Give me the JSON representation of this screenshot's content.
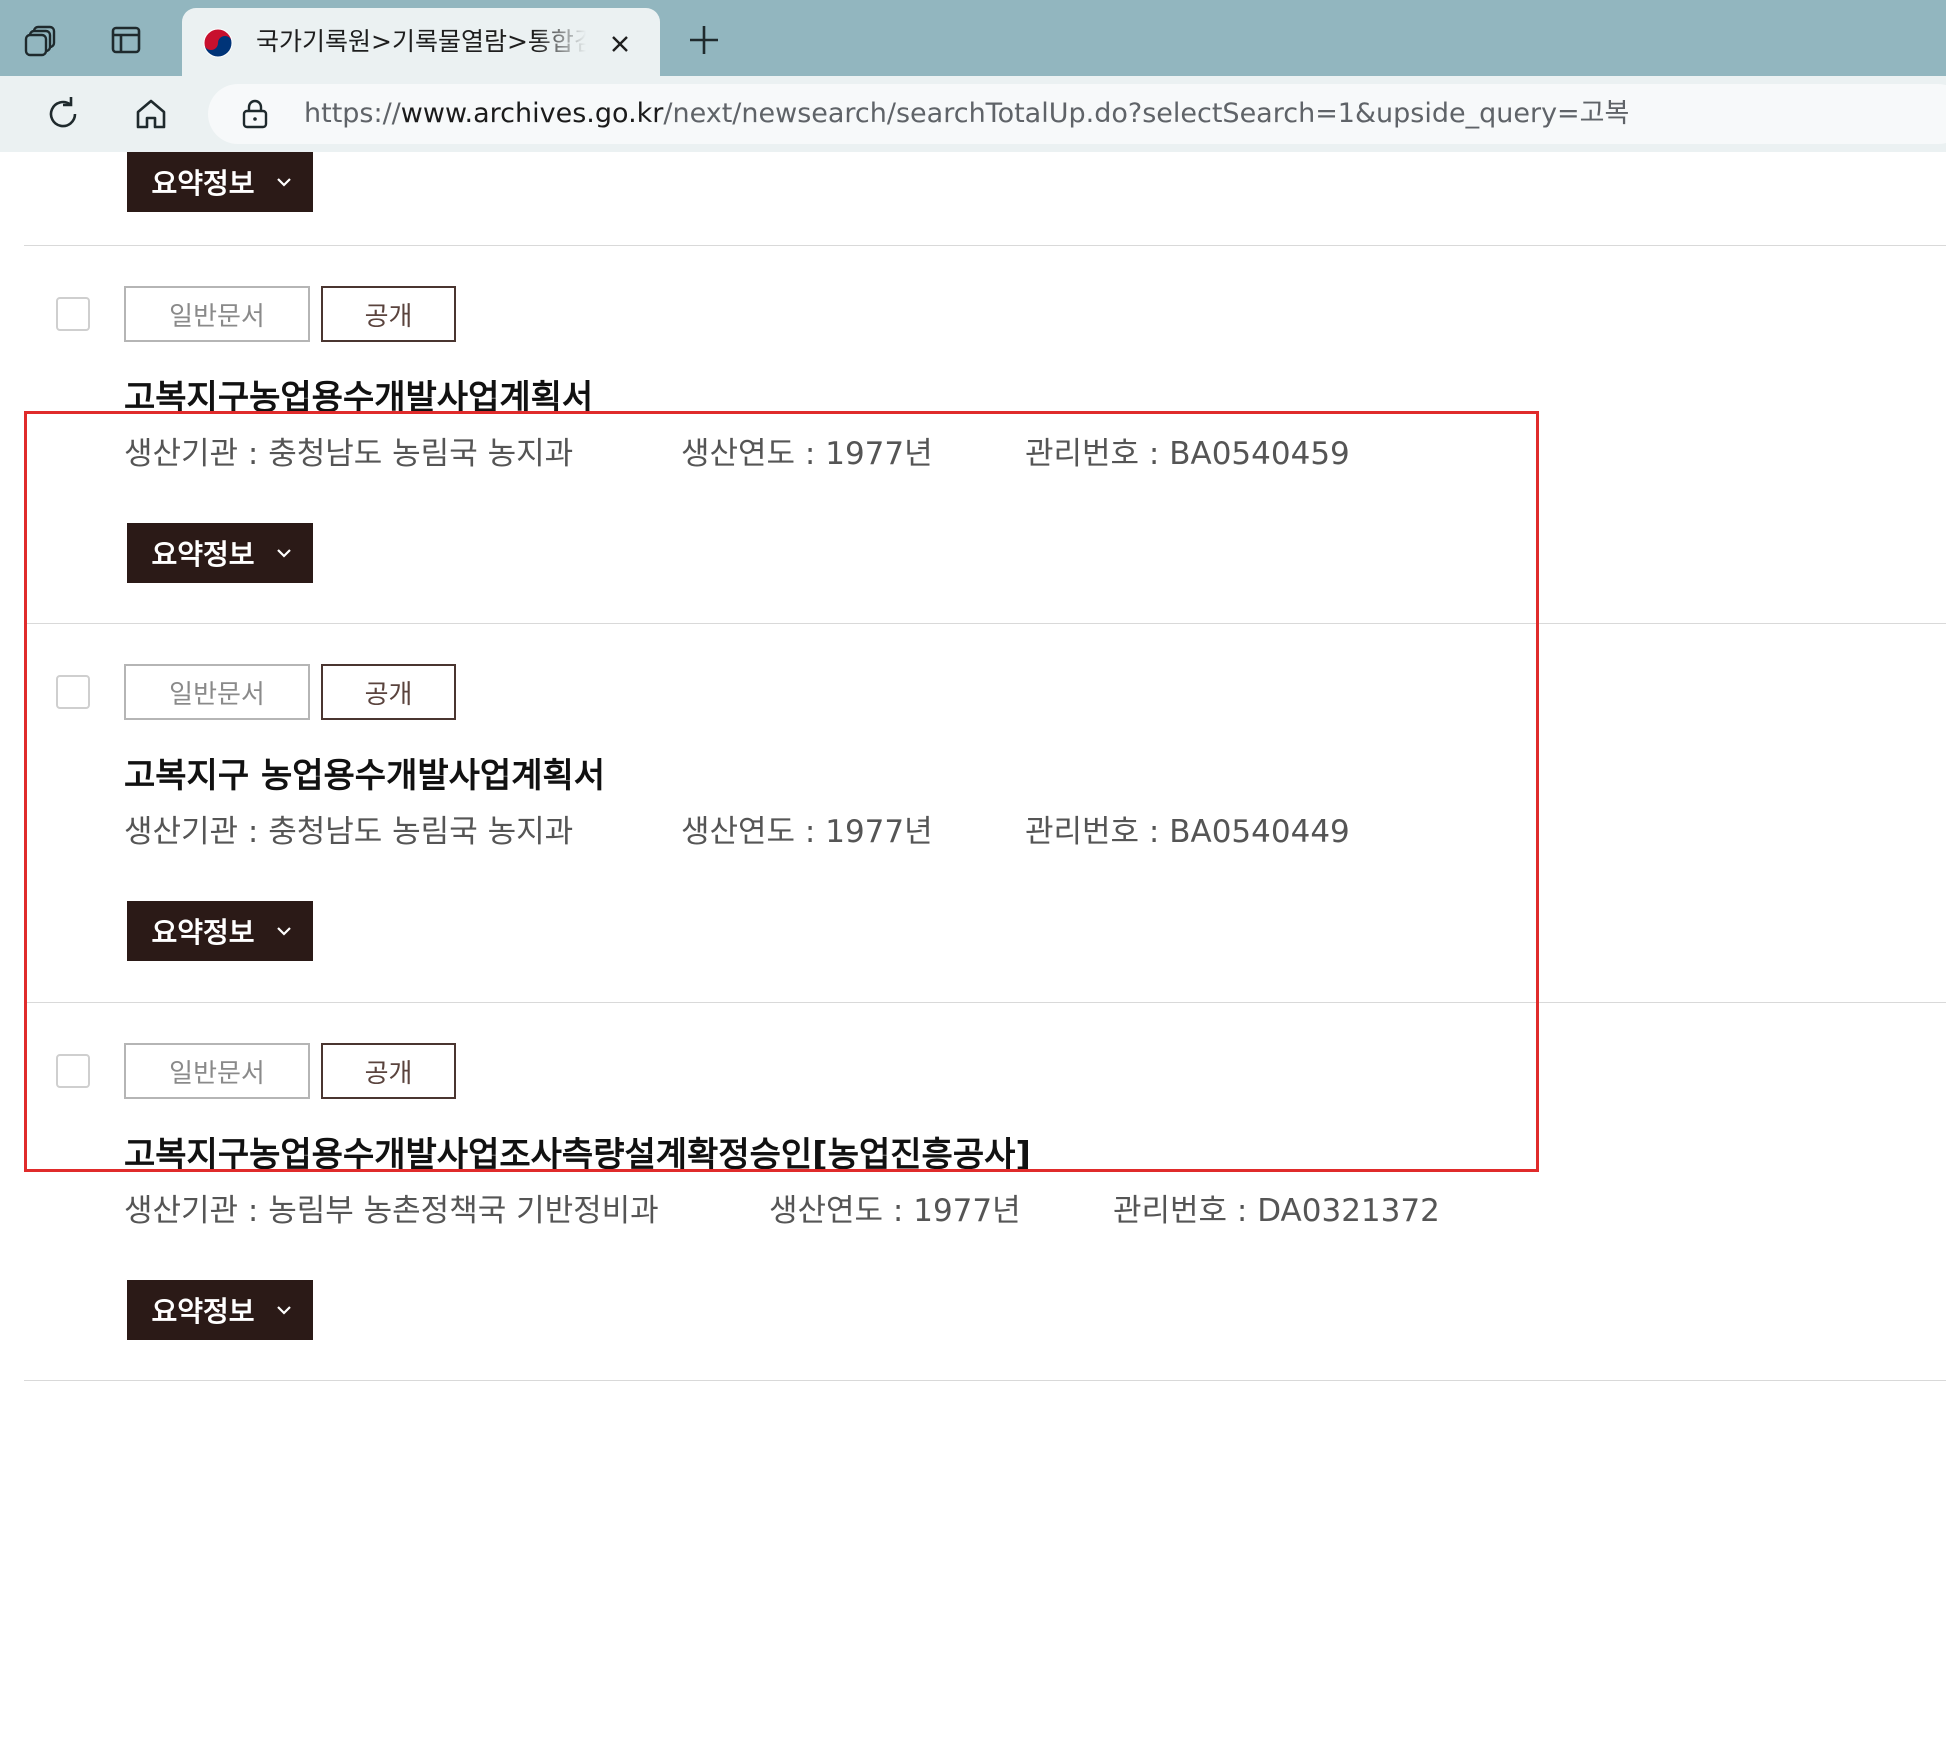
{
  "browser": {
    "tab_title": "국가기록원>기록물열람>통합검색",
    "url_scheme": "https://",
    "url_host": "www.archives.go.kr",
    "url_rest": "/next/newsearch/searchTotalUp.do?selectSearch=1&upside_query=고복"
  },
  "summary_label": "요약정보",
  "results": [
    {
      "type_badge": "일반문서",
      "access_badge": "공개",
      "title": "고복지구농업용수개발사업계획서",
      "producer": "생산기관 : 충청남도 농림국 농지과",
      "year": "생산연도 : 1977년",
      "id": "관리번호 : BA0540459"
    },
    {
      "type_badge": "일반문서",
      "access_badge": "공개",
      "title": "고복지구 농업용수개발사업계획서",
      "producer": "생산기관 : 충청남도 농림국 농지과",
      "year": "생산연도 : 1977년",
      "id": "관리번호 : BA0540449"
    },
    {
      "type_badge": "일반문서",
      "access_badge": "공개",
      "title": "고복지구농업용수개발사업조사측량설계확정승인[농업진흥공사]",
      "producer": "생산기관 : 농림부 농촌정책국 기반정비과",
      "year": "생산연도 : 1977년",
      "id": "관리번호 : DA0321372"
    }
  ],
  "colors": {
    "tab_strip": "#92b6bf",
    "summary_button": "#2b1a17",
    "highlight": "#e02b2b"
  }
}
